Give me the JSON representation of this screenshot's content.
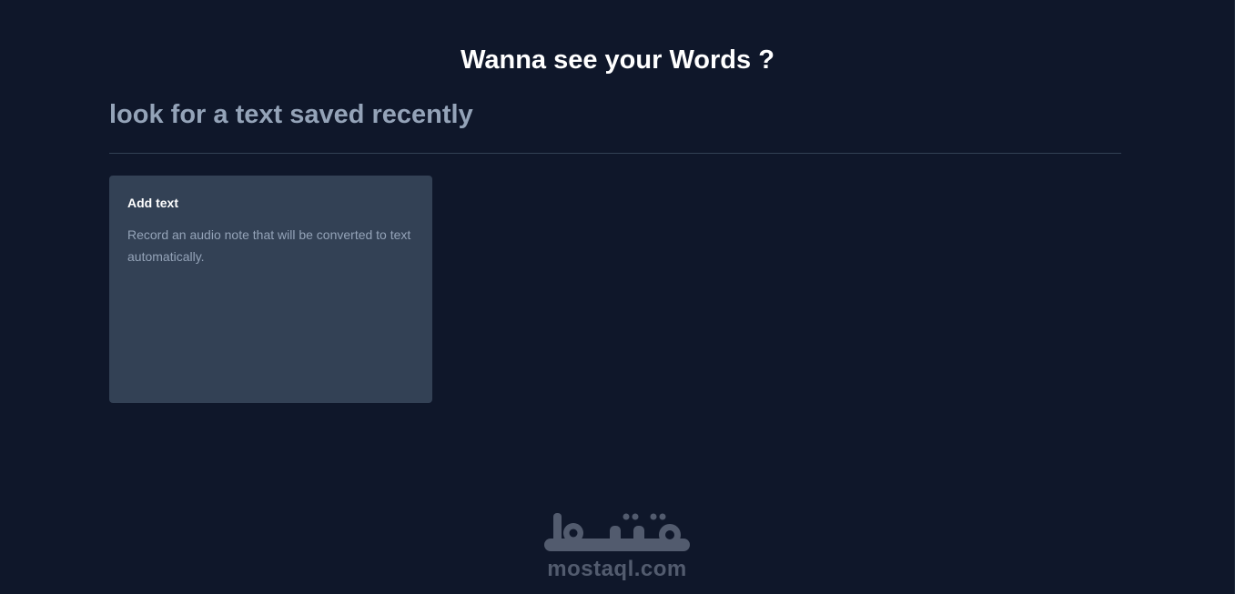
{
  "header": {
    "title": "Wanna see your Words ?"
  },
  "search": {
    "placeholder": "look for a text saved recently",
    "value": ""
  },
  "cards": [
    {
      "title": "Add text",
      "description": "Record an audio note that will be converted to text automatically."
    }
  ],
  "watermark": {
    "logo_text": "مستقل",
    "site": "mostaql.com"
  },
  "colors": {
    "background": "#0f172a",
    "card": "#334155",
    "muted_text": "#94a3b8",
    "divider": "#334155"
  }
}
